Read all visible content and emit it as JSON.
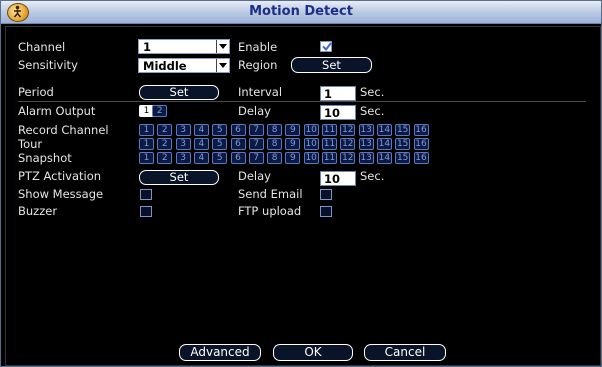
{
  "window": {
    "title": "Motion Detect"
  },
  "icons": {
    "app": "app-logo-icon",
    "dropdown": "chevron-down-icon",
    "check": "checkmark-icon"
  },
  "colors": {
    "title": "#1b2f86",
    "titlebar": "#b8c7e2",
    "box_border": "#5c78b8",
    "box_fill": "#0b1a44"
  },
  "form": {
    "channel_label": "Channel",
    "channel_value": "1",
    "enable_label": "Enable",
    "enable_checked": true,
    "sensitivity_label": "Sensitivity",
    "sensitivity_value": "Middle",
    "region_label": "Region",
    "region_button": "Set",
    "period_label": "Period",
    "period_button": "Set",
    "interval_label": "Interval",
    "interval_value": "1",
    "interval_unit": "Sec.",
    "alarm_output_label": "Alarm Output",
    "alarm_outputs": [
      {
        "label": "1",
        "selected": true
      },
      {
        "label": "2",
        "selected": false
      }
    ],
    "delay_label": "Delay",
    "delay_value": "10",
    "delay_unit": "Sec.",
    "record_channel_label": "Record Channel",
    "tour_label": "Tour",
    "snapshot_label": "Snapshot",
    "channels": [
      "1",
      "2",
      "3",
      "4",
      "5",
      "6",
      "7",
      "8",
      "9",
      "10",
      "11",
      "12",
      "13",
      "14",
      "15",
      "16"
    ],
    "ptz_label": "PTZ Activation",
    "ptz_button": "Set",
    "ptz_delay_label": "Delay",
    "ptz_delay_value": "10",
    "ptz_delay_unit": "Sec.",
    "show_message_label": "Show Message",
    "show_message_checked": false,
    "send_email_label": "Send Email",
    "send_email_checked": false,
    "buzzer_label": "Buzzer",
    "buzzer_checked": false,
    "ftp_upload_label": "FTP upload",
    "ftp_upload_checked": false
  },
  "footer": {
    "advanced": "Advanced",
    "ok": "OK",
    "cancel": "Cancel"
  }
}
